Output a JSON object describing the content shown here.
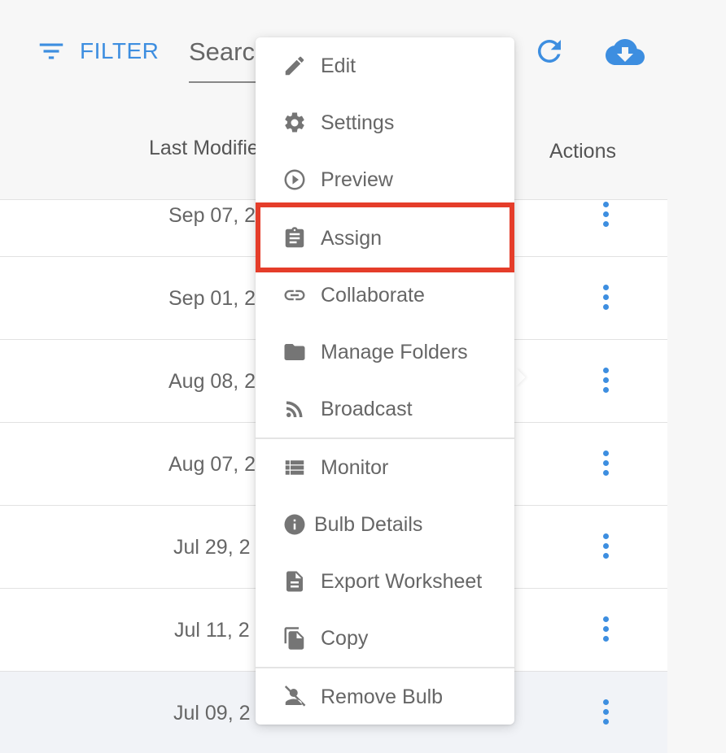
{
  "toolbar": {
    "filter_label": "FILTER",
    "search_placeholder": "Search",
    "refresh_icon": "refresh-icon",
    "download_icon": "cloud-download-icon",
    "accent_color": "#3d8ee0"
  },
  "table": {
    "columns": {
      "last_modified": "Last Modified",
      "actions": "Actions"
    },
    "rows": [
      {
        "date": "Sep 07, 2"
      },
      {
        "date": "Sep 01, 2"
      },
      {
        "date": "Aug 08, 2"
      },
      {
        "date": "Aug 07, 2"
      },
      {
        "date": "Jul 29, 2"
      },
      {
        "date": "Jul 11, 2"
      },
      {
        "date": "Jul 09, 2"
      }
    ]
  },
  "menu": {
    "highlight_color": "#e53d2a",
    "items": [
      {
        "label": "Edit",
        "icon": "pencil-icon"
      },
      {
        "label": "Settings",
        "icon": "gear-icon"
      },
      {
        "label": "Preview",
        "icon": "play-circle-icon"
      },
      {
        "label": "Assign",
        "icon": "clipboard-icon"
      },
      {
        "label": "Collaborate",
        "icon": "link-icon"
      },
      {
        "label": "Manage Folders",
        "icon": "folder-icon"
      },
      {
        "label": "Broadcast",
        "icon": "rss-icon"
      },
      {
        "label": "Monitor",
        "icon": "list-icon"
      },
      {
        "label": "Bulb Details",
        "icon": "info-icon"
      },
      {
        "label": "Export Worksheet",
        "icon": "document-icon"
      },
      {
        "label": "Copy",
        "icon": "copy-icon"
      },
      {
        "label": "Remove Bulb",
        "icon": "remove-person-icon"
      }
    ]
  }
}
